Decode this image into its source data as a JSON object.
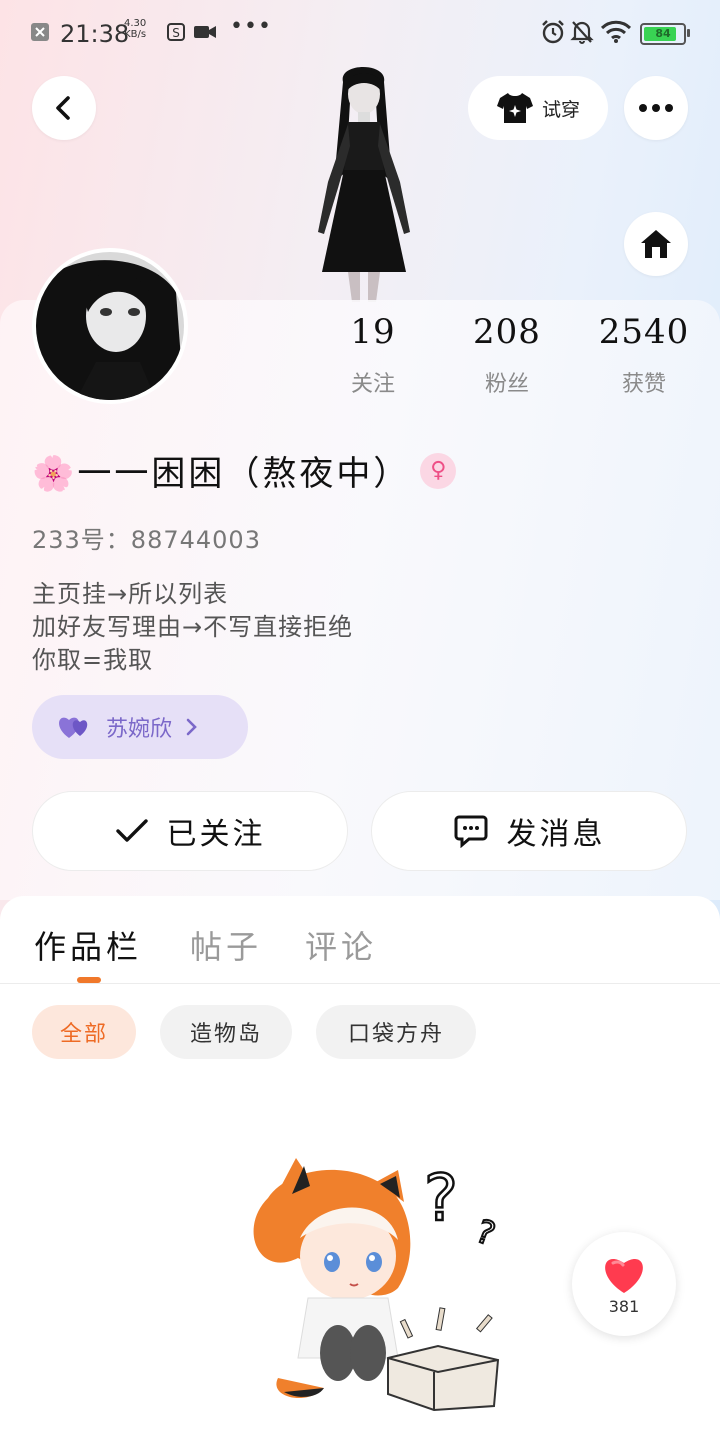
{
  "status_bar": {
    "time": "21:38",
    "net_speed_value": "4.30",
    "net_speed_unit": "KB/s",
    "battery": "84",
    "battery_level": 0.84
  },
  "header": {
    "tryon_label": "试穿"
  },
  "profile": {
    "stats": [
      {
        "value": "19",
        "label": "关注"
      },
      {
        "value": "208",
        "label": "粉丝"
      },
      {
        "value": "2540",
        "label": "获赞"
      }
    ],
    "name": "🌸一一困困（熬夜中）",
    "uid": "233号：88744003",
    "bio": [
      "主页挂→所以列表",
      "加好友写理由→不写直接拒绝",
      "你取=我取"
    ],
    "couple_name": "苏婉欣"
  },
  "actions": {
    "follow_label": "已关注",
    "message_label": "发消息"
  },
  "tabs": [
    {
      "label": "作品栏",
      "active": true
    },
    {
      "label": "帖子",
      "active": false
    },
    {
      "label": "评论",
      "active": false
    }
  ],
  "filters": [
    {
      "label": "全部",
      "active": true
    },
    {
      "label": "造物岛",
      "active": false
    },
    {
      "label": "口袋方舟",
      "active": false
    }
  ],
  "like_fab": {
    "count": "381"
  },
  "colors": {
    "accent": "#f0782a",
    "chip_active_bg": "#fde7dc",
    "couple_chip_bg": "#e6e0f7",
    "couple_purple": "#7b68c9",
    "heart_red": "#ff3b4f"
  }
}
